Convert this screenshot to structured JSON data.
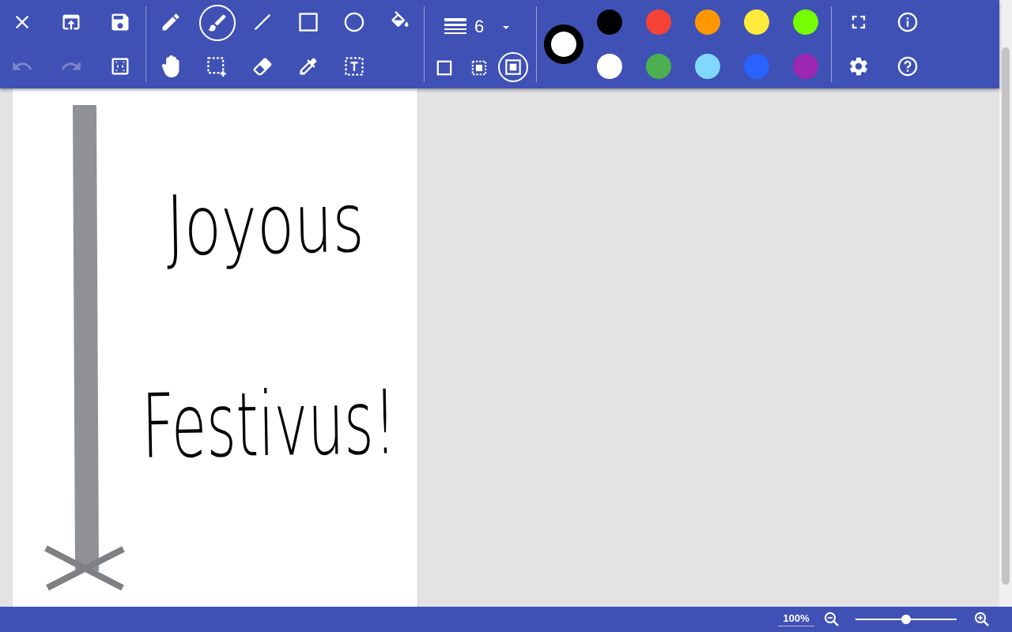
{
  "colors": {
    "toolbar_bg": "#3f51b5",
    "palette": [
      {
        "name": "black",
        "hex": "#000000"
      },
      {
        "name": "red",
        "hex": "#f44336"
      },
      {
        "name": "orange",
        "hex": "#ff9800"
      },
      {
        "name": "yellow",
        "hex": "#ffeb3b"
      },
      {
        "name": "lime",
        "hex": "#76ff03"
      },
      {
        "name": "white",
        "hex": "#ffffff"
      },
      {
        "name": "green",
        "hex": "#4caf50"
      },
      {
        "name": "light-blue",
        "hex": "#80d8ff"
      },
      {
        "name": "blue",
        "hex": "#2962ff"
      },
      {
        "name": "purple",
        "hex": "#9c27b0"
      }
    ],
    "current": "#ffffff",
    "pole_grey": "#909194"
  },
  "tools": {
    "icons": [
      "close-icon",
      "open-icon",
      "save-icon",
      "undo-icon",
      "redo-icon",
      "fit-page-icon",
      "pencil-icon",
      "brush-icon",
      "line-icon",
      "rectangle-icon",
      "ellipse-icon",
      "fill-bucket-icon",
      "pan-hand-icon",
      "select-rectangle-icon",
      "eraser-icon",
      "color-picker-icon",
      "text-icon",
      "fullscreen-icon",
      "info-icon",
      "settings-icon",
      "help-icon"
    ],
    "active": "brush",
    "undo_enabled": false,
    "redo_enabled": false
  },
  "brush": {
    "size": "6",
    "fill_modes": [
      "outline-only",
      "outline-and-fill",
      "fill-only"
    ],
    "selected_fill_mode": "fill-only"
  },
  "canvas": {
    "line1": "Joyous",
    "line2": "Festivus!"
  },
  "status": {
    "zoom_label": "100%",
    "zoom_level_fraction": 0.5
  }
}
